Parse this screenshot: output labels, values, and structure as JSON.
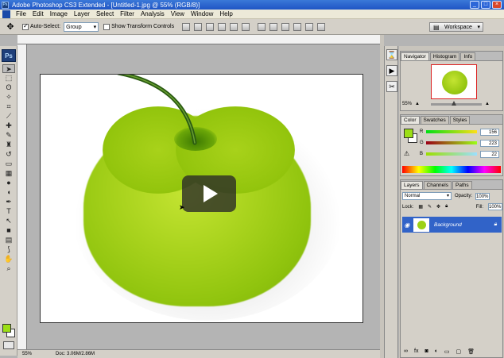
{
  "window": {
    "title": "Adobe Photoshop CS3 Extended - [Untitled-1.jpg @ 55% (RGB/8)]",
    "buttons": [
      "_",
      "□",
      "×"
    ]
  },
  "menu": [
    "File",
    "Edit",
    "Image",
    "Layer",
    "Select",
    "Filter",
    "Analysis",
    "View",
    "Window",
    "Help"
  ],
  "options": {
    "auto_select_label": "Auto-Select:",
    "auto_select_value": "Group",
    "transform_label": "Show Transform Controls",
    "workspace_label": "Workspace"
  },
  "tools": {
    "ps_badge": "Ps"
  },
  "status": {
    "zoom": "55%",
    "doc": "Doc: 3.06M/2.86M"
  },
  "navigator": {
    "tabs": [
      "Navigator",
      "Histogram",
      "Info"
    ],
    "zoom": "55%"
  },
  "color_panel": {
    "tabs": [
      "Color",
      "Swatches",
      "Styles"
    ],
    "channels": [
      {
        "label": "R",
        "value": "156"
      },
      {
        "label": "G",
        "value": "223"
      },
      {
        "label": "B",
        "value": "22"
      }
    ],
    "foreground": "#9cdf16"
  },
  "layers_panel": {
    "tabs": [
      "Layers",
      "Channels",
      "Paths"
    ],
    "blend_mode": "Normal",
    "opacity_label": "Opacity:",
    "opacity_value": "100%",
    "lock_label": "Lock:",
    "fill_label": "Fill:",
    "fill_value": "100%",
    "layers": [
      {
        "name": "Background"
      }
    ]
  }
}
